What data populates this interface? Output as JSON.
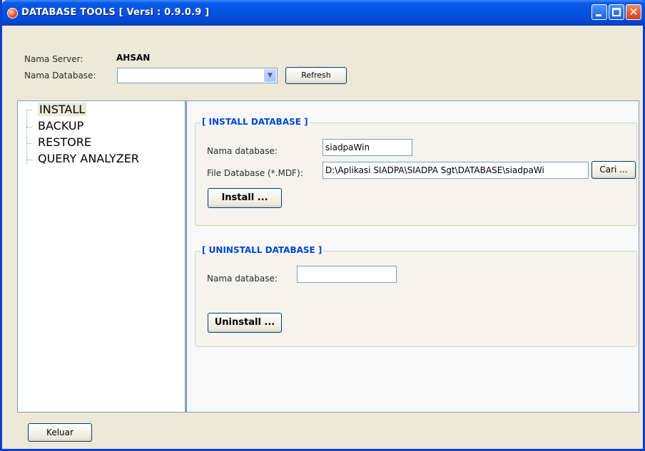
{
  "window": {
    "title": "DATABASE TOOLS [ Versi : 0.9.0.9 ]"
  },
  "header": {
    "server_label": "Nama Server:",
    "server_value": "AHSAN",
    "database_label": "Nama Database:",
    "database_value": "",
    "refresh_label": "Refresh"
  },
  "sidebar": {
    "items": [
      {
        "label": "INSTALL"
      },
      {
        "label": "BACKUP"
      },
      {
        "label": "RESTORE"
      },
      {
        "label": "QUERY ANALYZER"
      }
    ],
    "selected": "INSTALL"
  },
  "install": {
    "title": "[ INSTALL DATABASE ]",
    "name_label": "Nama database:",
    "name_value": "siadpaWin",
    "file_label": "File Database (*.MDF):",
    "file_value": "D:\\Aplikasi SIADPA\\SIADPA Sgt\\DATABASE\\siadpaWi",
    "browse_label": "Cari ...",
    "install_label": "Install ..."
  },
  "uninstall": {
    "title": "[ UNINSTALL DATABASE ]",
    "name_label": "Nama database:",
    "name_value": "",
    "uninstall_label": "Uninstall ..."
  },
  "footer": {
    "exit_label": "Keluar"
  },
  "colors": {
    "titlebar": "#0553e0",
    "group_title": "#0046d5",
    "window_bg": "#ece9d8"
  },
  "icons": {
    "app": "app-icon",
    "minimize": "minimize-icon",
    "maximize": "maximize-icon",
    "close": "close-icon",
    "dropdown": "chevron-down-icon"
  }
}
